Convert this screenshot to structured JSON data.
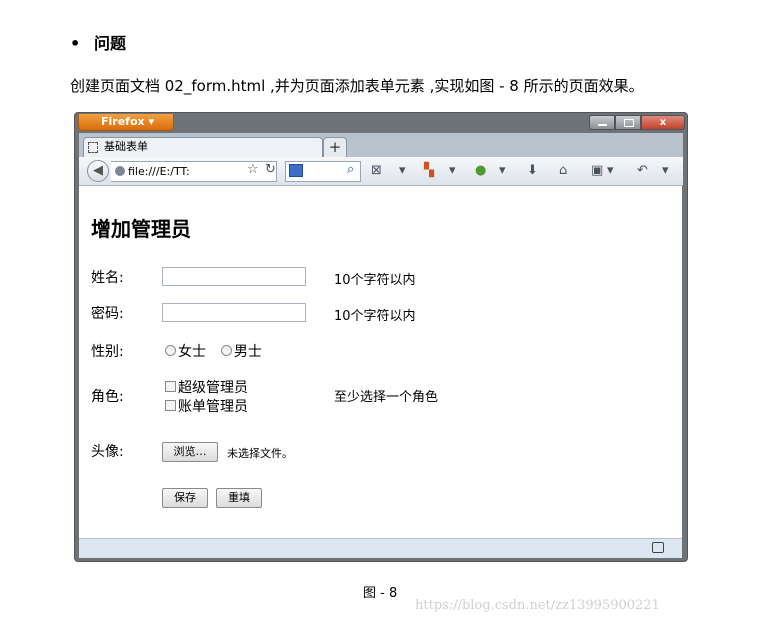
{
  "doc": {
    "bullet": "•",
    "heading": "问题",
    "description": "创建页面文档 02_form.html ,并为页面添加表单元素 ,实现如图 - 8 所示的页面效果。",
    "caption": "图 - 8",
    "watermark": "https://blog.csdn.net/zz13995900221"
  },
  "browser": {
    "app_button": "Firefox ▾",
    "tab_title": "基础表单",
    "new_tab": "+",
    "url": "file:///E:/TT:",
    "back_glyph": "◀",
    "close_glyph": "x",
    "toolbar_icons": [
      "reload-icon",
      "bookmark-star-icon",
      "search-engine-icon",
      "web-developer-icon",
      "addon-icon",
      "download-icon",
      "home-icon",
      "bookmarks-menu-icon",
      "back-history-icon"
    ]
  },
  "page": {
    "title": "增加管理员",
    "name_label": "姓名:",
    "name_hint": "10个字符以内",
    "password_label": "密码:",
    "password_hint": "10个字符以内",
    "gender_label": "性别:",
    "gender_female": "女士",
    "gender_male": "男士",
    "role_label": "角色:",
    "role_super": "超级管理员",
    "role_billing": "账单管理员",
    "role_hint": "至少选择一个角色",
    "avatar_label": "头像:",
    "browse_button": "浏览…",
    "no_file": "未选择文件。",
    "save_button": "保存",
    "reset_button": "重填"
  }
}
